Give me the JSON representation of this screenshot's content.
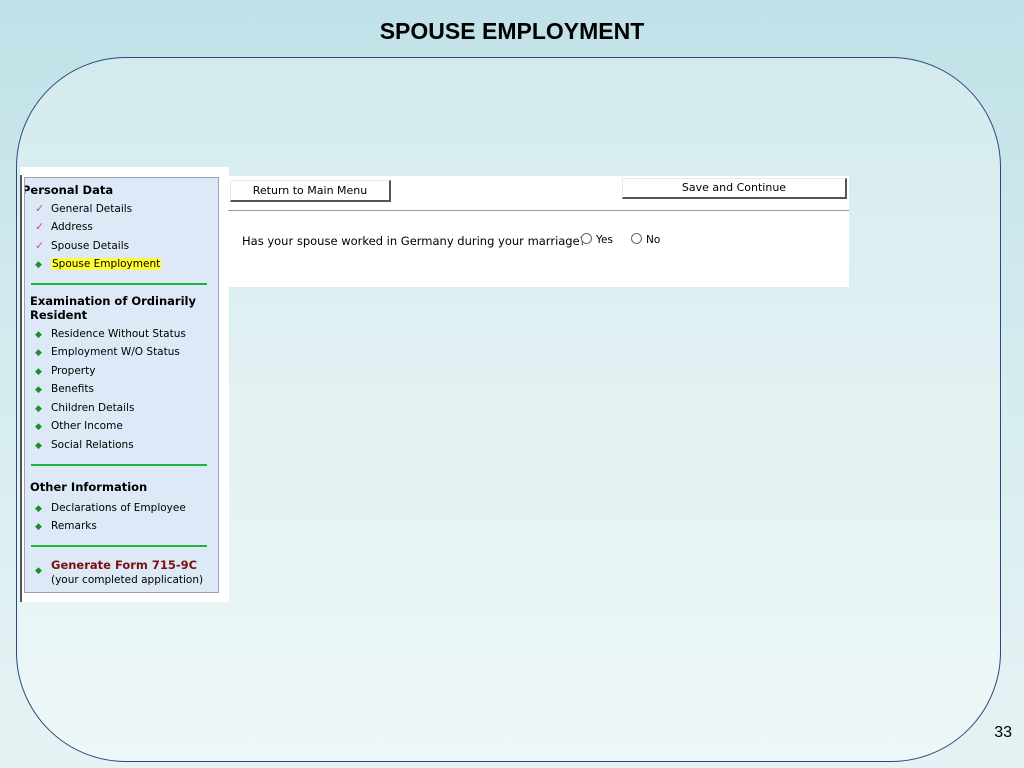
{
  "slide": {
    "title": "SPOUSE EMPLOYMENT",
    "page_number": "33"
  },
  "sidebar": {
    "personal_data": {
      "heading": "Personal Data",
      "items": [
        {
          "label": "General Details",
          "marker": "check-icon"
        },
        {
          "label": "Address",
          "marker": "check-icon"
        },
        {
          "label": "Spouse Details",
          "marker": "check-icon"
        },
        {
          "label": "Spouse Employment",
          "marker": "diamond-icon",
          "active": true
        }
      ]
    },
    "examination": {
      "heading_line1": "Examination of Ordinarily",
      "heading_line2": "Resident",
      "items": [
        {
          "label": "Residence Without Status"
        },
        {
          "label": "Employment W/O Status"
        },
        {
          "label": "Property"
        },
        {
          "label": "Benefits"
        },
        {
          "label": "Children Details"
        },
        {
          "label": "Other Income"
        },
        {
          "label": "Social Relations"
        }
      ]
    },
    "other_information": {
      "heading": "Other Information",
      "items": [
        {
          "label": "Declarations of Employee"
        },
        {
          "label": "Remarks"
        }
      ]
    },
    "generate": {
      "title": "Generate Form 715-9C",
      "subtitle": "(your completed application)"
    }
  },
  "toolbar": {
    "return_label": "Return to Main Menu",
    "save_label": "Save and Continue"
  },
  "form": {
    "question": "Has your spouse worked in Germany during your marriage?",
    "options": [
      {
        "label": "Yes",
        "selected": false
      },
      {
        "label": "No",
        "selected": false
      }
    ]
  },
  "colors": {
    "active_highlight": "#ffff33",
    "divider": "#22b33a",
    "generate_link": "#7a1010",
    "sidebar_bg": "#dde9f7"
  }
}
